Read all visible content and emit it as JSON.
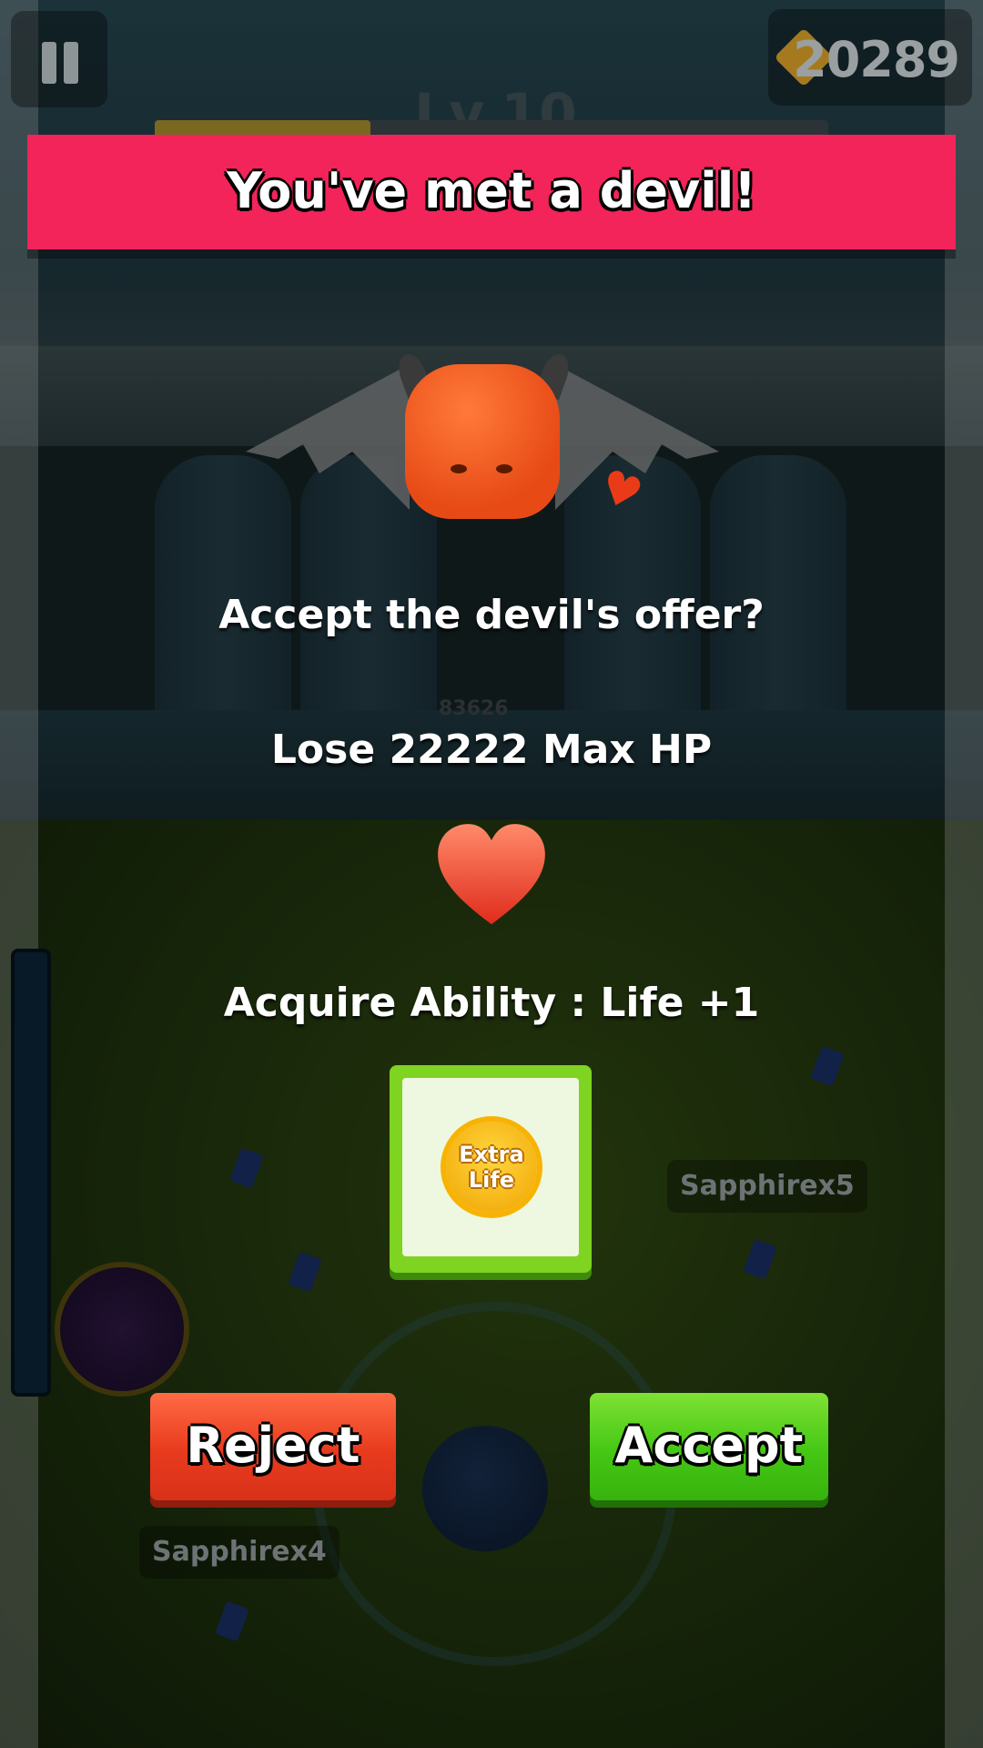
{
  "hud": {
    "pause_icon": "pause-icon",
    "coins": "20289",
    "coin_icon": "arrow-diamond-icon",
    "level": "Lv.10",
    "xp_fraction": 0.32
  },
  "dialog": {
    "title": "You've met a devil!",
    "question": "Accept the devil's offer?",
    "cost": "Lose 22222 Max HP",
    "reward": "Acquire Ability : Life +1",
    "ability_card": {
      "line1": "Extra",
      "line2": "Life"
    },
    "buttons": {
      "reject": "Reject",
      "accept": "Accept"
    }
  },
  "world": {
    "enemy_hp": "83626",
    "nametags": [
      "Sapphirex5",
      "Sapphirex4"
    ]
  },
  "colors": {
    "banner": "#f2245a",
    "reject": "#e83a1d",
    "accept": "#45c714",
    "card": "#7fd321"
  }
}
